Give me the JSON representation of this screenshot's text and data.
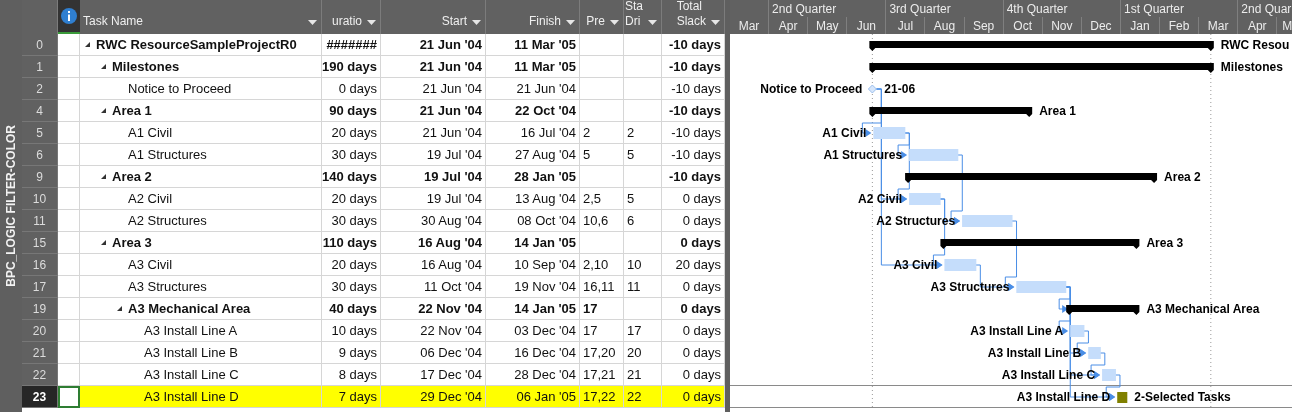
{
  "side_label": "BPC_LOGIC FILTER-COLOR",
  "columns": [
    "Task Name",
    "uratio",
    "Start",
    "Finish",
    "Pre",
    "Sta\nDri",
    "Total\nSlack"
  ],
  "timescale": {
    "quarters": [
      "2nd Quarter",
      "3rd Quarter",
      "4th Quarter",
      "1st Quarter",
      "2nd Quar"
    ],
    "months": [
      "Mar",
      "Apr",
      "May",
      "Jun",
      "Jul",
      "Aug",
      "Sep",
      "Oct",
      "Nov",
      "Dec",
      "Jan",
      "Feb",
      "Mar",
      "Apr",
      "M"
    ]
  },
  "tasks": [
    {
      "id": "0",
      "name": "RWC ResourceSampleProjectR0",
      "kind": "summary",
      "expanded": true,
      "selected": false,
      "duration": "#######",
      "start": "21 Jun '04",
      "finish": "11 Mar '05",
      "total_slack": "-10 days",
      "gantt_right_label": "RWC Resou",
      "children": [
        {
          "id": "1",
          "name": "Milestones",
          "kind": "summary",
          "expanded": true,
          "selected": false,
          "duration": "190 days",
          "start": "21 Jun '04",
          "finish": "11 Mar '05",
          "total_slack": "-10 days",
          "gantt_right_label": "Milestones",
          "children": [
            {
              "id": "2",
              "name": "Notice to Proceed",
              "kind": "milestone",
              "selected": false,
              "duration": "0 days",
              "start": "21 Jun '04",
              "finish": "21 Jun '04",
              "total_slack": "-10 days",
              "gantt_left_label": "Notice to Proceed",
              "gantt_right_label": "21-06"
            }
          ]
        },
        {
          "id": "4",
          "name": "Area 1",
          "kind": "summary",
          "expanded": true,
          "selected": false,
          "duration": "90 days",
          "start": "21 Jun '04",
          "finish": "22 Oct '04",
          "total_slack": "-10 days",
          "gantt_right_label": "Area 1",
          "children": [
            {
              "id": "5",
              "name": "A1 Civil",
              "kind": "task",
              "selected": false,
              "duration": "20 days",
              "start": "21 Jun '04",
              "finish": "16 Jul '04",
              "predecessors": "2",
              "column_7": "2",
              "total_slack": "-10 days",
              "gantt_left_label": "A1 Civil"
            },
            {
              "id": "6",
              "name": "A1 Structures",
              "kind": "task",
              "selected": false,
              "duration": "30 days",
              "start": "19 Jul '04",
              "finish": "27 Aug '04",
              "predecessors": "5",
              "column_7": "5",
              "total_slack": "-10 days",
              "gantt_left_label": "A1 Structures"
            }
          ]
        },
        {
          "id": "9",
          "name": "Area 2",
          "kind": "summary",
          "expanded": true,
          "selected": false,
          "duration": "140 days",
          "start": "19 Jul '04",
          "finish": "28 Jan '05",
          "total_slack": "-10 days",
          "gantt_right_label": "Area 2",
          "children": [
            {
              "id": "10",
              "name": "A2 Civil",
              "kind": "task",
              "selected": false,
              "duration": "20 days",
              "start": "19 Jul '04",
              "finish": "13 Aug '04",
              "predecessors": "2,5",
              "column_7": "5",
              "total_slack": "0 days",
              "gantt_left_label": "A2 Civil"
            },
            {
              "id": "11",
              "name": "A2 Structures",
              "kind": "task",
              "selected": false,
              "duration": "30 days",
              "start": "30 Aug '04",
              "finish": "08 Oct '04",
              "predecessors": "10,6",
              "column_7": "6",
              "total_slack": "0 days",
              "gantt_left_label": "A2 Structures"
            }
          ]
        },
        {
          "id": "15",
          "name": "Area 3",
          "kind": "summary",
          "expanded": true,
          "selected": false,
          "duration": "110 days",
          "start": "16 Aug '04",
          "finish": "14 Jan '05",
          "total_slack": "0 days",
          "gantt_right_label": "Area 3",
          "children": [
            {
              "id": "16",
              "name": "A3 Civil",
              "kind": "task",
              "selected": false,
              "duration": "20 days",
              "start": "16 Aug '04",
              "finish": "10 Sep '04",
              "predecessors": "2,10",
              "column_7": "10",
              "total_slack": "20 days",
              "gantt_left_label": "A3 Civil"
            },
            {
              "id": "17",
              "name": "A3 Structures",
              "kind": "task",
              "selected": false,
              "duration": "30 days",
              "start": "11 Oct '04",
              "finish": "19 Nov '04",
              "predecessors": "16,11",
              "column_7": "11",
              "total_slack": "0 days",
              "gantt_left_label": "A3 Structures"
            },
            {
              "id": "19",
              "name": "A3 Mechanical Area",
              "kind": "summary",
              "expanded": true,
              "selected": false,
              "duration": "40 days",
              "start": "22 Nov '04",
              "finish": "14 Jan '05",
              "predecessors": "17",
              "total_slack": "0 days",
              "gantt_right_label": "A3 Mechanical Area",
              "children": [
                {
                  "id": "20",
                  "name": "A3 Install Line A",
                  "kind": "task",
                  "selected": false,
                  "duration": "10 days",
                  "start": "22 Nov '04",
                  "finish": "03 Dec '04",
                  "predecessors": "17",
                  "column_7": "17",
                  "total_slack": "0 days",
                  "gantt_left_label": "A3 Install Line A"
                },
                {
                  "id": "21",
                  "name": "A3 Install Line B",
                  "kind": "task",
                  "selected": false,
                  "duration": "9 days",
                  "start": "06 Dec '04",
                  "finish": "16 Dec '04",
                  "predecessors": "17,20",
                  "column_7": "20",
                  "total_slack": "0 days",
                  "gantt_left_label": "A3 Install Line B"
                },
                {
                  "id": "22",
                  "name": "A3 Install Line C",
                  "kind": "task",
                  "selected": false,
                  "duration": "8 days",
                  "start": "17 Dec '04",
                  "finish": "28 Dec '04",
                  "predecessors": "17,21",
                  "column_7": "21",
                  "total_slack": "0 days",
                  "gantt_left_label": "A3 Install Line C"
                },
                {
                  "id": "23",
                  "name": "A3 Install Line D",
                  "kind": "task",
                  "selected": true,
                  "duration": "7 days",
                  "start": "29 Dec '04",
                  "finish": "06 Jan '05",
                  "predecessors": "17,22",
                  "column_7": "22",
                  "total_slack": "0 days",
                  "gantt_left_label": "A3 Install Line D",
                  "gantt_right_label": "2-Selected Tasks"
                }
              ]
            }
          ]
        }
      ]
    }
  ]
}
